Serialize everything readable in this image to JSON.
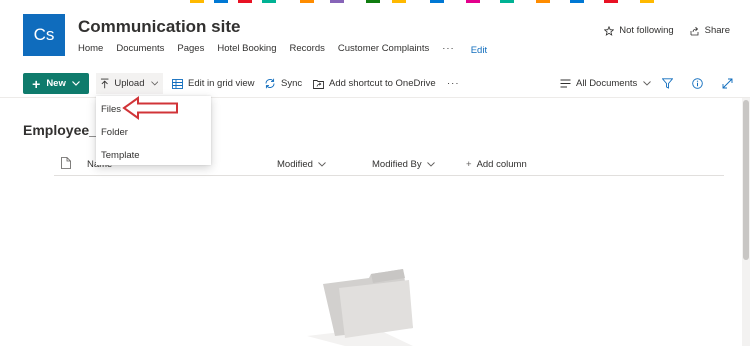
{
  "colors": {
    "brand_blue": "#0f6cbd",
    "new_button_green": "#0f7b6c",
    "annotation_arrow": "#d13438"
  },
  "site": {
    "logo_initials": "Cs",
    "title": "Communication site",
    "nav": [
      "Home",
      "Documents",
      "Pages",
      "Hotel Booking",
      "Records",
      "Customer Complaints"
    ],
    "nav_more": "···",
    "nav_edit": "Edit",
    "follow_label": "Not following",
    "share_label": "Share"
  },
  "commandbar": {
    "new_label": "New",
    "upload_label": "Upload",
    "grid_label": "Edit in grid view",
    "sync_label": "Sync",
    "shortcut_label": "Add shortcut to OneDrive",
    "more": "···",
    "view_label": "All Documents",
    "icons": [
      "plus-icon",
      "upload-icon",
      "grid-icon",
      "sync-icon",
      "shortcut-icon",
      "view-list-icon",
      "filter-icon",
      "info-icon",
      "expand-icon"
    ]
  },
  "upload_menu": {
    "items": [
      "Files",
      "Folder",
      "Template"
    ]
  },
  "library": {
    "title": "Employee_Re",
    "columns": {
      "name": "Name",
      "modified": "Modified",
      "modified_by": "Modified By",
      "add": "Add column"
    }
  }
}
